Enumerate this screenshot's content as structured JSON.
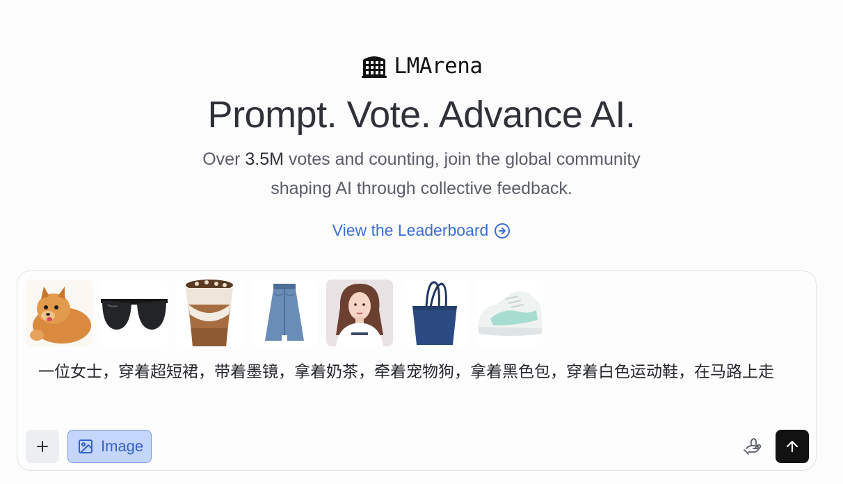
{
  "brand": {
    "name": "LMArena",
    "icon": "arena-building-icon"
  },
  "hero": {
    "headline": "Prompt. Vote. Advance AI.",
    "sub_prefix": "Over ",
    "sub_highlight": "3.5M",
    "sub_line1_rest": " votes and counting, join the global community",
    "sub_line2": "shaping AI through collective feedback.",
    "leaderboard_link": "View the Leaderboard",
    "leaderboard_icon": "arrow-right-circle-icon"
  },
  "composer": {
    "attachments": [
      {
        "name": "pomeranian-dog"
      },
      {
        "name": "black-sunglasses"
      },
      {
        "name": "milk-tea-cup"
      },
      {
        "name": "denim-skirt"
      },
      {
        "name": "woman-portrait"
      },
      {
        "name": "navy-tote-bag"
      },
      {
        "name": "white-sneaker"
      }
    ],
    "prompt_text": "一位女士，穿着超短裙，带着墨镜，拿着奶茶，牵着宠物狗，拿着黑色包，穿着白色运动鞋，在马路上走",
    "mode_button_label": "Image",
    "accent_color": "#3661c9",
    "icons": {
      "add": "plus-icon",
      "mode": "image-icon",
      "hand": "hand-icon",
      "send": "arrow-up-icon"
    }
  }
}
